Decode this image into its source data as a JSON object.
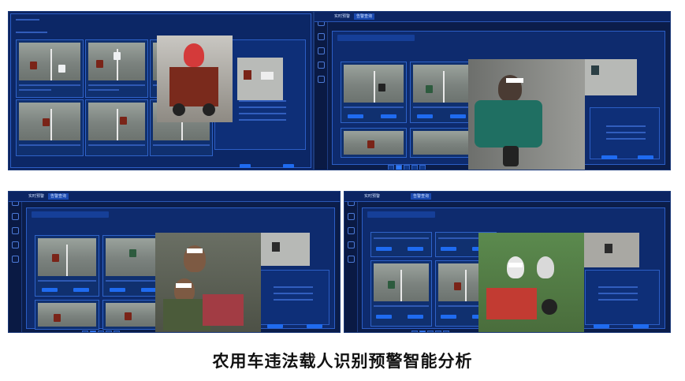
{
  "caption": "农用车违法载人识别预警智能分析",
  "screens": {
    "s2": {
      "tabs": [
        "实时预警",
        "告警查询"
      ]
    },
    "s3": {
      "tabs": [
        "实时预警",
        "告警查询"
      ]
    },
    "s4": {
      "tabs": [
        "实时预警",
        "告警查询"
      ]
    }
  },
  "colors": {
    "app_bg": "#0b1d4a",
    "panel": "#0e2b6e",
    "accent": "#1f6bf0",
    "border": "#2f63c9"
  },
  "icons": [
    "home-icon",
    "alarm-icon",
    "video-icon",
    "settings-icon",
    "user-icon"
  ]
}
